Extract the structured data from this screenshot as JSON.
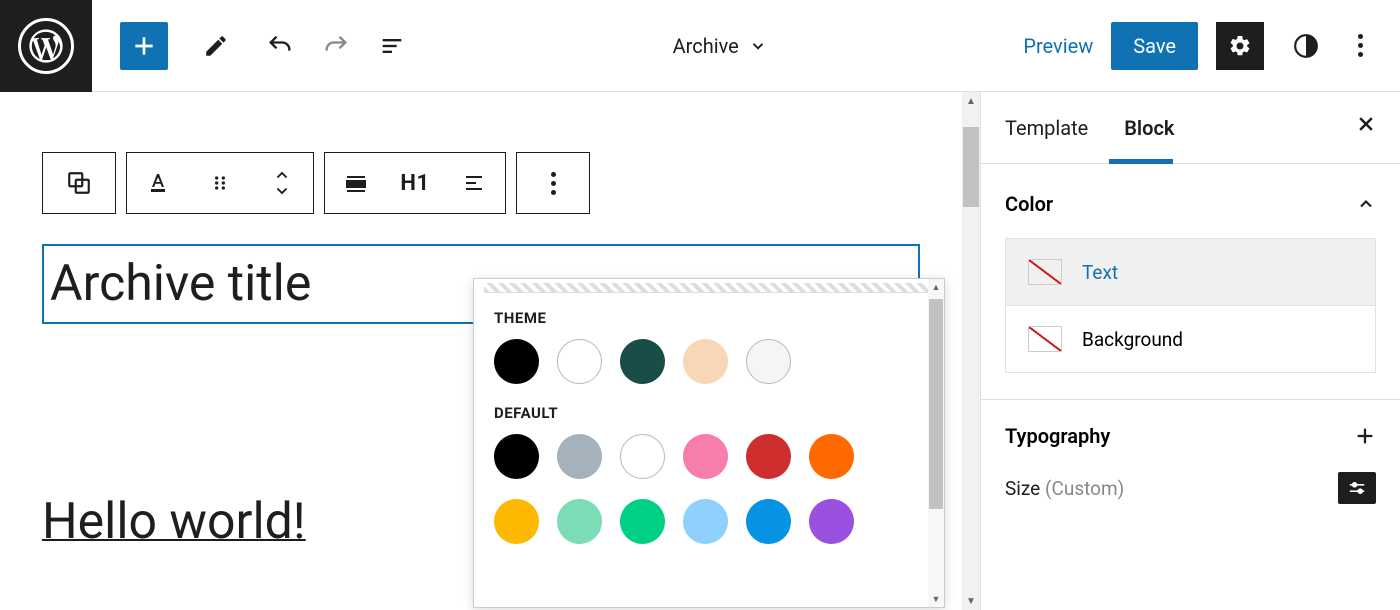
{
  "topbar": {
    "doc_title": "Archive",
    "preview_label": "Preview",
    "save_label": "Save"
  },
  "canvas": {
    "block_toolbar": {
      "heading_tag": "H1"
    },
    "title_text": "Archive title",
    "link_text": "Hello world!"
  },
  "color_popover": {
    "theme_label": "THEME",
    "default_label": "DEFAULT",
    "theme_colors": [
      "#000000",
      "#ffffff",
      "#1a4d47",
      "#f8d7b6",
      "#f5f5f5"
    ],
    "default_colors_row1": [
      "#000000",
      "#a6b2bb",
      "#ffffff",
      "#f77eac",
      "#cf2e2e",
      "#ff6900"
    ],
    "default_colors_row2": [
      "#fcb900",
      "#7bdcb5",
      "#00d084",
      "#8ed1fc",
      "#0693e3",
      "#9b51e0"
    ]
  },
  "sidebar": {
    "tabs": {
      "template": "Template",
      "block": "Block"
    },
    "color_section": {
      "title": "Color",
      "text_label": "Text",
      "background_label": "Background"
    },
    "typography": {
      "title": "Typography",
      "size_label": "Size",
      "size_value": "(Custom)"
    }
  }
}
